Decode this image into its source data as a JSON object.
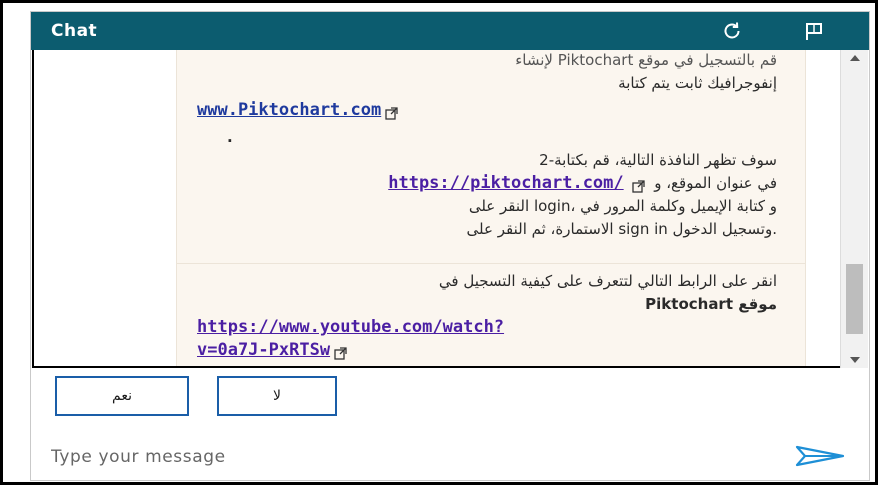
{
  "header": {
    "title": "Chat",
    "refresh_icon": "refresh-icon",
    "flag_icon": "flag-icon"
  },
  "messages": [
    {
      "lines": [
        "إنفوجرافيك ثابت يتم كتابة",
        "www.Piktochart.com",
        ".",
        "سوف تظهر النافذة التالية، قم بكتابة-2",
        "في عنوان الموقع، و",
        "https://piktochart.com/",
        "و كتابة الإيميل وكلمة المرور في ،login النقر على",
        ".وتسجيل الدخول sign in الاستمارة، ثم النقر على"
      ],
      "partial_top": "قم بالتسجيل في موقع Piktochart لإنشاء"
    },
    {
      "lines": [
        "انقر على الرابط التالي لتتعرف على كيفية التسجيل في",
        "موقع Piktochart",
        "https://www.youtube.com/watch?",
        "v=0a7J-PxRTSw"
      ]
    }
  ],
  "quick_replies": {
    "yes_label": "نعم",
    "no_label": "لا"
  },
  "composer": {
    "placeholder": "Type your message",
    "send_icon": "send-icon"
  },
  "colors": {
    "header_bg": "#0c5c6f",
    "bubble_bg": "#fbf6ef",
    "link": "#1f3a9e",
    "visited_link": "#4b1fa3",
    "button_border": "#1a5ea8",
    "send": "#1e8fd6"
  }
}
